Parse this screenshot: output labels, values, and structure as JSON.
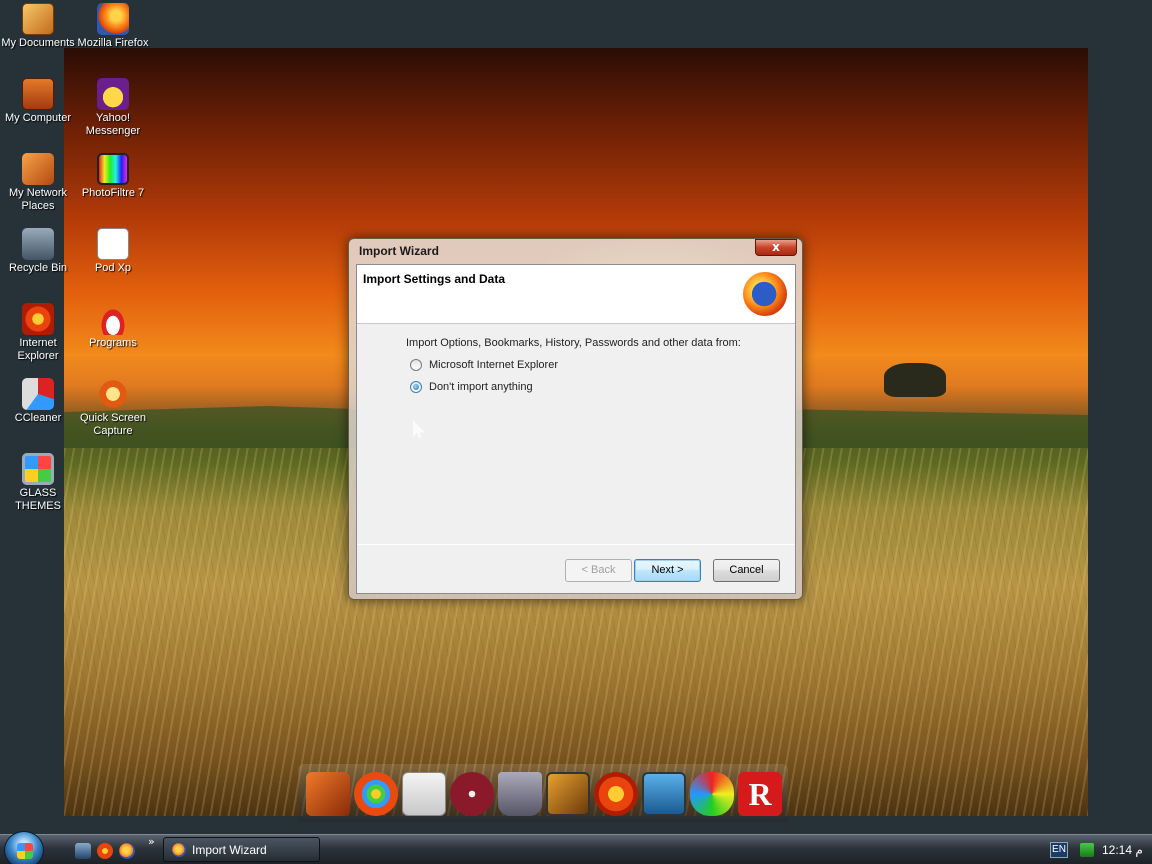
{
  "desktop": {
    "icons": [
      {
        "label": "My Documents",
        "icon": "my-documents-icon"
      },
      {
        "label": "Mozilla Firefox",
        "icon": "firefox-icon"
      },
      {
        "label": "My Computer",
        "icon": "my-computer-icon"
      },
      {
        "label": "Yahoo! Messenger",
        "icon": "yahoo-messenger-icon"
      },
      {
        "label": "My Network Places",
        "icon": "network-places-icon"
      },
      {
        "label": "PhotoFiltre 7",
        "icon": "photofiltre-icon"
      },
      {
        "label": "Recycle Bin",
        "icon": "recycle-bin-icon"
      },
      {
        "label": "Pod Xp",
        "icon": "pod-xp-icon"
      },
      {
        "label": "Internet Explorer",
        "icon": "internet-explorer-icon"
      },
      {
        "label": "Programs",
        "icon": "programs-icon"
      },
      {
        "label": "CCleaner",
        "icon": "ccleaner-icon"
      },
      {
        "label": "Quick Screen Capture",
        "icon": "quick-screen-capture-icon"
      },
      {
        "label": "GLASS THEMES",
        "icon": "glass-themes-icon"
      }
    ]
  },
  "dialog": {
    "title": "Import Wizard",
    "close_glyph": "x",
    "header_title": "Import Settings and Data",
    "intro": "Import Options, Bookmarks, History, Passwords and other data from:",
    "options": [
      {
        "label": "Microsoft Internet Explorer",
        "checked": false
      },
      {
        "label": "Don't import anything",
        "checked": true
      }
    ],
    "buttons": {
      "back": "< Back",
      "next": "Next >",
      "cancel": "Cancel"
    }
  },
  "dock": {
    "icons": [
      "media-player-icon",
      "windows-logo-icon",
      "disk-drive-icon",
      "dvd-icon",
      "recycle-bin-icon",
      "photo-gallery-icon",
      "internet-explorer-icon",
      "laptop-icon",
      "paint-icon",
      "r-app-icon"
    ]
  },
  "taskbar": {
    "quicklaunch_chevron": "»",
    "task_button_label": "Import Wizard",
    "language": "EN",
    "clock": "12:14 م"
  }
}
